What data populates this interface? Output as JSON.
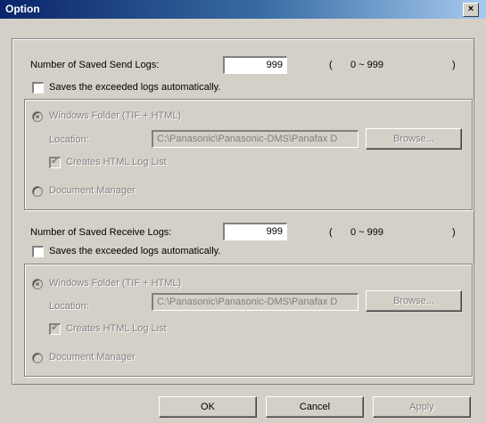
{
  "window": {
    "title": "Option",
    "close_glyph": "×"
  },
  "send": {
    "count_label": "Number of Saved Send Logs:",
    "count_value": "999",
    "range_open": "(",
    "range_text": "0 ~  999",
    "range_close": ")",
    "auto_save_label": "Saves the exceeded logs automatically.",
    "windows_folder_label": "Windows Folder (TIF + HTML)",
    "location_label": "Location:",
    "location_value": "C:\\Panasonic\\Panasonic-DMS\\Panafax D",
    "browse_label": "Browse...",
    "html_log_label": "Creates HTML Log List",
    "doc_manager_label": "Document Manager"
  },
  "receive": {
    "count_label": "Number of Saved Receive Logs:",
    "count_value": "999",
    "range_open": "(",
    "range_text": "0 ~  999",
    "range_close": ")",
    "auto_save_label": "Saves the exceeded logs automatically.",
    "windows_folder_label": "Windows Folder (TIF + HTML)",
    "location_label": "Location:",
    "location_value": "C:\\Panasonic\\Panasonic-DMS\\Panafax D",
    "browse_label": "Browse...",
    "html_log_label": "Creates HTML Log List",
    "doc_manager_label": "Document Manager"
  },
  "buttons": {
    "ok": "OK",
    "cancel": "Cancel",
    "apply": "Apply"
  },
  "icons": {
    "check": "check-icon",
    "close": "close-icon"
  }
}
